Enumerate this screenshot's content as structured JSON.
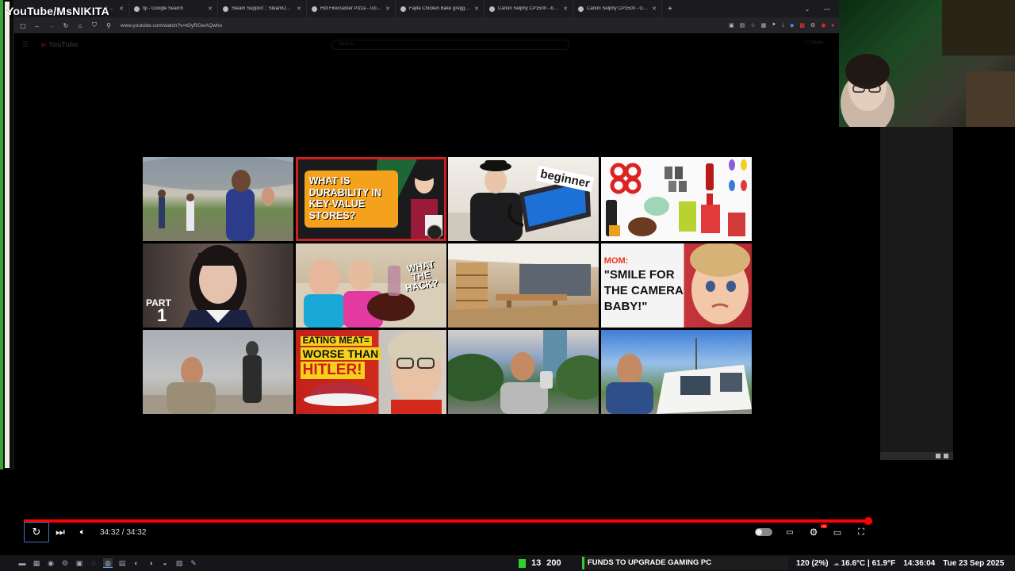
{
  "watermark": "YouTube/MsNIKITA",
  "browser": {
    "tabs": [
      {
        "label": "I Think I Just Found The Best C..."
      },
      {
        "label": "fiji - Google Search"
      },
      {
        "label": "Steam Support :: SteamOS Inst..."
      },
      {
        "label": "Hot Firecracker Pizza - Google ..."
      },
      {
        "label": "Fajita Chicken Bake greggs - G..."
      },
      {
        "label": "Canon Selphy CP1500 - buy at ..."
      },
      {
        "label": "Canon Selphy CP1500 - Google ..."
      }
    ],
    "new_tab": "+",
    "url": "www.youtube.com/watch?v=tGyRGwAQwho"
  },
  "youtube": {
    "logo": "YouTube",
    "search_placeholder": "Search",
    "create": "Create"
  },
  "thumbnails": {
    "t2_text": "WHAT IS DURABILITY IN KEY-VALUE STORES?",
    "t3_text": "beginner",
    "t5_text_part": "PART",
    "t5_text_num": "1",
    "t6_text_1": "WHAT",
    "t6_text_2": "THE",
    "t6_text_3": "HACK?",
    "t8_text_mom": "MOM:",
    "t8_text_1": "\"SMILE FOR",
    "t8_text_2": "THE CAMERA",
    "t8_text_3": "BABY!\"",
    "t10_text_1": "EATING MEAT=",
    "t10_text_2": "WORSE THAN",
    "t10_text_3": "HITLER!"
  },
  "player": {
    "time_display": "34:32 / 34:32",
    "progress_fraction": 1.0
  },
  "taskbar": {
    "count_current": "13",
    "count_total": "200",
    "goal_label": "FUNDS TO UPGRADE GAMING PC",
    "cpu": "120 (2%)",
    "temp": "16.6°C | 61.9°F",
    "clock": "14:36:04",
    "date": "Tue 23 Sep 2025"
  },
  "colors": {
    "accent_red": "#ff0000",
    "goal_green": "#2fd12f"
  }
}
